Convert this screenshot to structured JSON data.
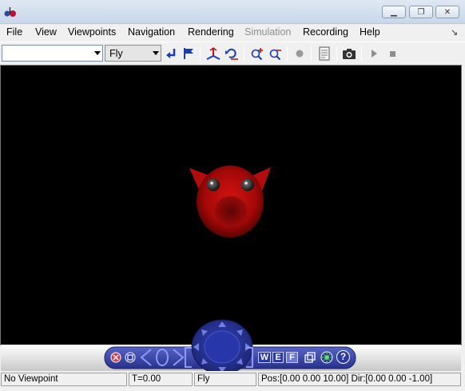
{
  "menu": {
    "items": [
      {
        "label": "File",
        "enabled": true
      },
      {
        "label": "View",
        "enabled": true
      },
      {
        "label": "Viewpoints",
        "enabled": true
      },
      {
        "label": "Navigation",
        "enabled": true
      },
      {
        "label": "Rendering",
        "enabled": true
      },
      {
        "label": "Simulation",
        "enabled": false
      },
      {
        "label": "Recording",
        "enabled": true
      },
      {
        "label": "Help",
        "enabled": true
      }
    ]
  },
  "toolbar": {
    "viewpoint_value": "",
    "nav_mode_value": "Fly",
    "icons": [
      "return-arrow-icon",
      "flag-icon",
      "straighten-icon",
      "undo-move-icon",
      "zoom-in-icon",
      "zoom-out-icon",
      "record-icon",
      "document-icon",
      "camera-icon",
      "play-icon",
      "stop-icon"
    ]
  },
  "scene": {
    "background_color": "#000000",
    "object_color": "#b80c0c",
    "object_name": "red-creature-model"
  },
  "nav_panel": {
    "buttons": [
      "close-icon",
      "minimize-icon",
      "rotate-left-icon",
      "orbit-icon",
      "rotate-right-icon",
      "pan-left-icon",
      "directional-pad",
      "pan-right-icon",
      "w-button",
      "e-button",
      "f-button",
      "layers-icon",
      "headlight-icon",
      "help-icon"
    ],
    "labels": {
      "w": "W",
      "e": "E",
      "f": "F",
      "help": "?"
    }
  },
  "status": {
    "viewpoint": "No Viewpoint",
    "time": "T=0.00",
    "mode": "Fly",
    "position": "Pos:[0.00 0.00 10.00] Dir:[0.00 0.00 -1.00]"
  }
}
